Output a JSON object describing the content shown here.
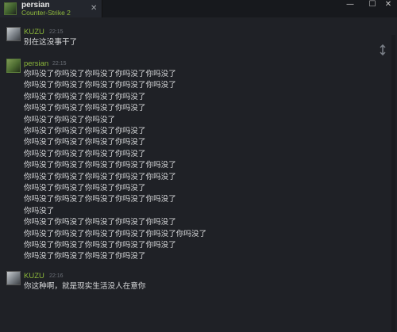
{
  "tab": {
    "name": "persian",
    "status": "Counter-Strike 2",
    "close_glyph": "✕"
  },
  "window_controls": {
    "minimize": "—",
    "maximize": "☐",
    "close": "✕"
  },
  "icons": {
    "avatar_kuzu": "avatar-icon",
    "avatar_persian": "avatar-icon",
    "scroll_lock": "scroll-lock-icon"
  },
  "messages": [
    {
      "sender": "KUZU",
      "time": "22:15",
      "lines": [
        "别在这没事干了"
      ]
    },
    {
      "sender": "persian",
      "time": "22:15",
      "lines": [
        "你吗没了你吗没了你吗没了你吗没了你吗没了",
        "你吗没了你吗没了你吗没了你吗没了你吗没了",
        "你吗没了你吗没了你吗没了你吗没了",
        "你吗没了你吗没了你吗没了你吗没了",
        "你吗没了你吗没了你吗没了",
        "你吗没了你吗没了你吗没了你吗没了",
        "你吗没了你吗没了你吗没了你吗没了",
        "你吗没了你吗没了你吗没了你吗没了",
        "你吗没了你吗没了你吗没了你吗没了你吗没了",
        "你吗没了你吗没了你吗没了你吗没了你吗没了",
        "你吗没了你吗没了你吗没了你吗没了",
        "你吗没了你吗没了你吗没了你吗没了你吗没了",
        "你吗没了",
        "你吗没了你吗没了你吗没了你吗没了你吗没了",
        "你吗没了你吗没了你吗没了你吗没了你吗没了你吗没了",
        "你吗没了你吗没了你吗没了你吗没了你吗没了",
        "你吗没了你吗没了你吗没了你吗没了"
      ]
    },
    {
      "sender": "KUZU",
      "time": "22:16",
      "lines": [
        "你这种啊，就是现实生活没人在意你"
      ]
    }
  ]
}
